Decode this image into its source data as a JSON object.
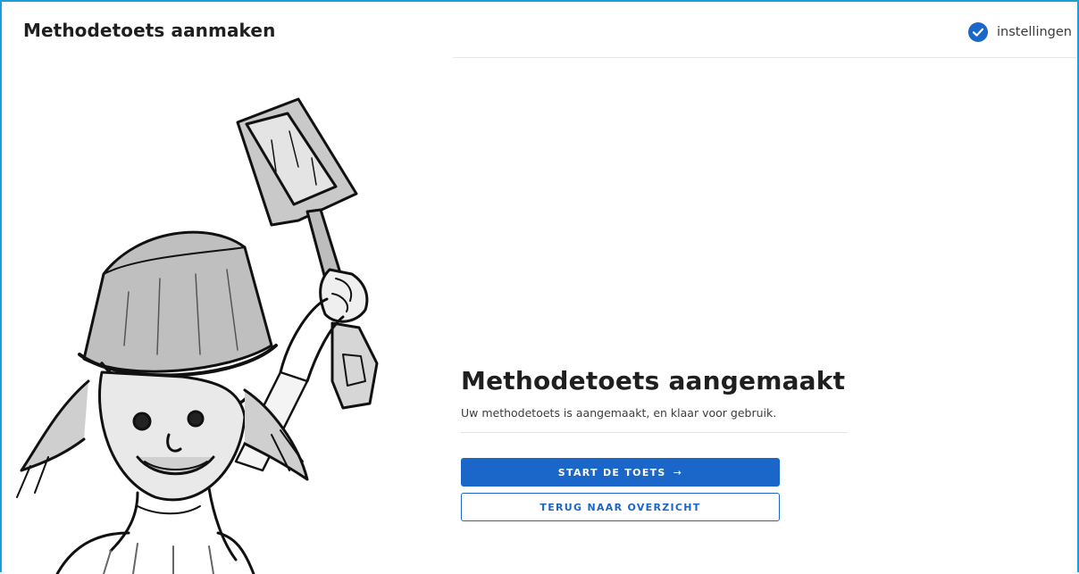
{
  "header": {
    "title": "Methodetoets aanmaken",
    "settings_label": "instellingen",
    "settings_icon": "check-circle-icon",
    "accent": "#1b66c9"
  },
  "main": {
    "title": "Methodetoets aangemaakt",
    "subtitle": "Uw methodetoets is aangemaakt, en klaar voor gebruik.",
    "start_button": "START DE TOETS",
    "start_arrow": "→",
    "back_button": "TERUG NAAR OVERZICHT"
  },
  "illustration": {
    "icon": "child-with-bucket-and-shovel-illustration"
  },
  "colors": {
    "frame_border": "#1aa0d8",
    "primary": "#1b66c9",
    "text": "#1f1f1f"
  }
}
